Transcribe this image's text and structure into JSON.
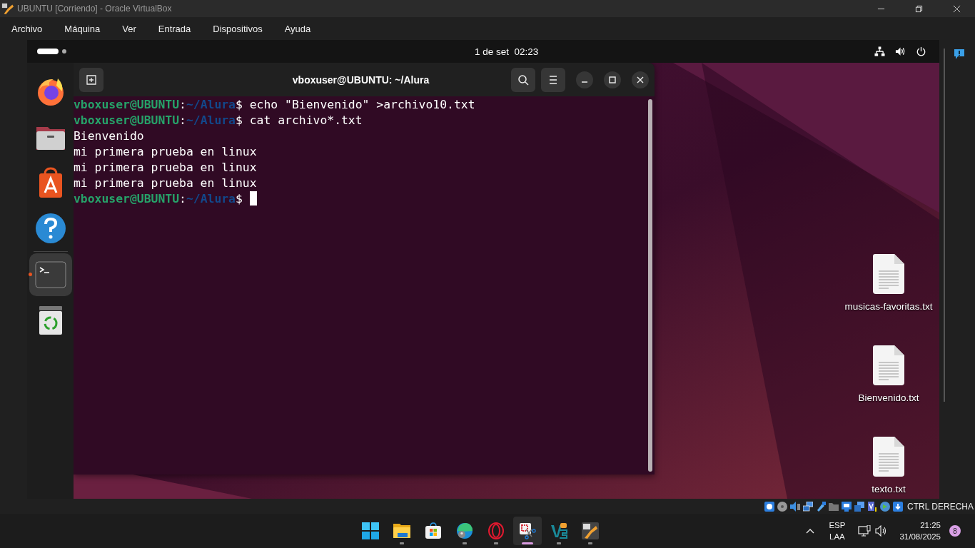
{
  "window": {
    "title": "UBUNTU [Corriendo] - Oracle VirtualBox"
  },
  "menu": [
    "Archivo",
    "Máquina",
    "Ver",
    "Entrada",
    "Dispositivos",
    "Ayuda"
  ],
  "guest": {
    "panel": {
      "clock": "1 de set  02:23"
    },
    "dock": [
      {
        "kind": "firefox",
        "running": false,
        "selected": false
      },
      {
        "kind": "files",
        "running": false,
        "selected": false
      },
      {
        "kind": "appcenter",
        "running": false,
        "selected": false
      },
      {
        "kind": "help",
        "running": false,
        "selected": false
      },
      {
        "kind": "terminal",
        "running": true,
        "selected": true
      },
      {
        "kind": "trash",
        "running": false,
        "selected": false
      }
    ],
    "terminal": {
      "title": "vboxuser@UBUNTU: ~/Alura",
      "lines": [
        {
          "kind": "prompt",
          "user": "vboxuser@UBUNTU",
          "sep": ":",
          "path": "~/Alura",
          "symbol": "$",
          "command": "echo \"Bienvenido\" >archivo10.txt",
          "cursor": false
        },
        {
          "kind": "prompt",
          "user": "vboxuser@UBUNTU",
          "sep": ":",
          "path": "~/Alura",
          "symbol": "$",
          "command": "cat archivo*.txt",
          "cursor": false
        },
        {
          "kind": "output",
          "text": "Bienvenido"
        },
        {
          "kind": "output",
          "text": "mi primera prueba en linux"
        },
        {
          "kind": "output",
          "text": "mi primera prueba en linux"
        },
        {
          "kind": "output",
          "text": "mi primera prueba en linux"
        },
        {
          "kind": "prompt",
          "user": "vboxuser@UBUNTU",
          "sep": ":",
          "path": "~/Alura",
          "symbol": "$",
          "cursor": true
        }
      ]
    },
    "desktop_icons": [
      {
        "label": "musicas-favoritas.txt"
      },
      {
        "label": "Bienvenido.txt"
      },
      {
        "label": "texto.txt"
      }
    ]
  },
  "vbox_status": {
    "host_key": "CTRL DERECHA"
  },
  "taskbar": {
    "apps": [
      {
        "kind": "start",
        "running": false,
        "selected": false
      },
      {
        "kind": "explorer",
        "running": true,
        "selected": false
      },
      {
        "kind": "store",
        "running": false,
        "selected": false
      },
      {
        "kind": "edge",
        "running": true,
        "selected": false
      },
      {
        "kind": "opera",
        "running": true,
        "selected": false
      },
      {
        "kind": "snipping",
        "running": true,
        "selected": true
      },
      {
        "kind": "vs",
        "running": true,
        "selected": false
      },
      {
        "kind": "virtualbox",
        "running": true,
        "selected": false
      }
    ],
    "language": [
      "ESP",
      "LAA"
    ],
    "time": "21:25",
    "date": "31/08/2025",
    "notifications": "8"
  }
}
